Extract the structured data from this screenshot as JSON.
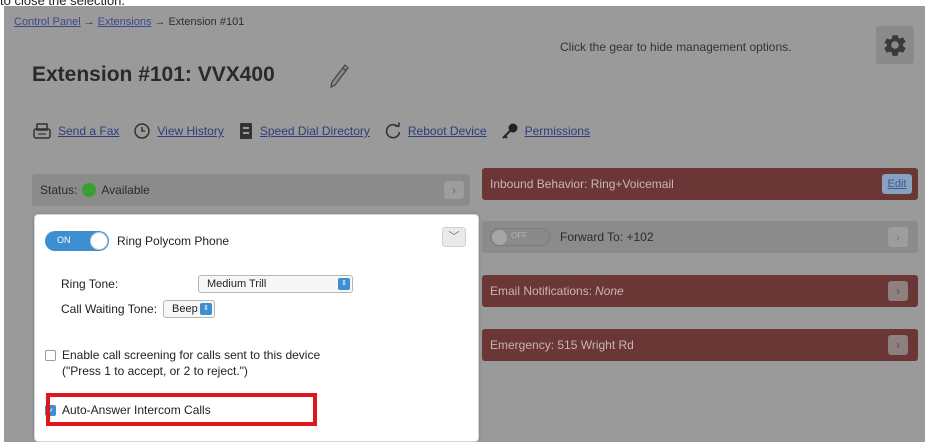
{
  "top_caption": "to close the selection.",
  "breadcrumb": {
    "items": [
      "Control Panel",
      "Extensions",
      "Extension #101"
    ],
    "separator": "→"
  },
  "header": {
    "title": "Extension #101: VVX400",
    "hint": "Click the gear to hide management options."
  },
  "actions": [
    {
      "label": "Send a Fax",
      "icon": "fax-icon"
    },
    {
      "label": "View History",
      "icon": "history-icon"
    },
    {
      "label": "Speed Dial Directory",
      "icon": "directory-icon"
    },
    {
      "label": "Reboot Device",
      "icon": "reboot-icon"
    },
    {
      "label": "Permissions",
      "icon": "key-icon"
    }
  ],
  "status": {
    "label": "Status:",
    "value": "Available",
    "color": "#3aa033"
  },
  "right_panels": {
    "inbound": {
      "text": "Inbound Behavior: Ring+Voicemail",
      "edit_label": "Edit"
    },
    "forward": {
      "toggle_text": "OFF",
      "label": "Forward To: +102"
    },
    "email": {
      "prefix": "Email Notifications: ",
      "value": "None"
    },
    "emergency": {
      "text": "Emergency: 515 Wright Rd"
    }
  },
  "card": {
    "toggle_text": "ON",
    "title": "Ring Polycom Phone",
    "ring_tone_label": "Ring Tone:",
    "ring_tone_value": "Medium Trill",
    "call_waiting_label": "Call Waiting Tone:",
    "call_waiting_value": "Beep",
    "screening_line1": "Enable call screening for calls sent to this device",
    "screening_line2": "(\"Press 1 to accept, or 2 to reject.\")",
    "screening_checked": false,
    "auto_answer_label": "Auto-Answer Intercom Calls",
    "auto_answer_checked": true
  },
  "colors": {
    "accent": "#3d8fd2",
    "panel_red": "#6a3636",
    "highlight": "#e0161d",
    "status_green": "#3aa033"
  }
}
